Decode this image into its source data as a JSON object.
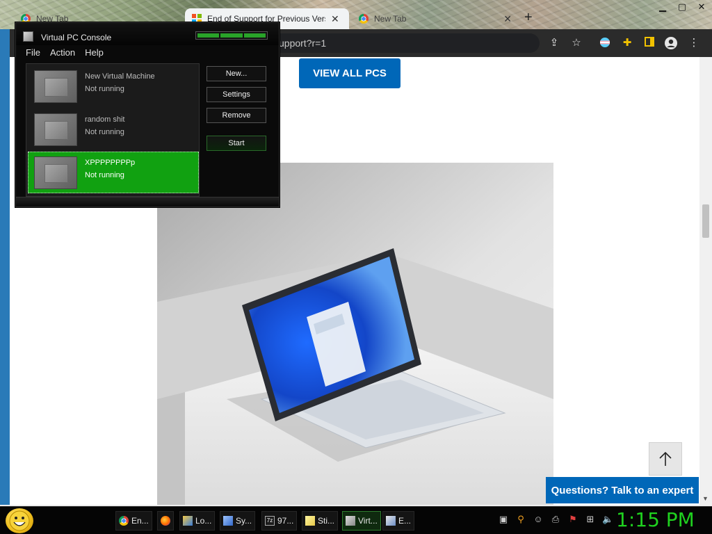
{
  "browser": {
    "tabs": [
      {
        "label": "New Tab",
        "active": false
      },
      {
        "label": "End of Support for Previous Vers",
        "active": true
      },
      {
        "label": "New Tab",
        "active": false
      }
    ],
    "url": "upport?r=1"
  },
  "page": {
    "view_all_label": "VIEW ALL PCS",
    "questions_label": "Questions? Talk to an expert"
  },
  "vpc": {
    "title": "Virtual PC Console",
    "menu": [
      "File",
      "Action",
      "Help"
    ],
    "machines": [
      {
        "name": "New Virtual Machine",
        "status": "Not running",
        "selected": false
      },
      {
        "name": "random shit",
        "status": "Not running",
        "selected": false
      },
      {
        "name": "XPPPPPPPPp",
        "status": "Not running",
        "selected": true
      }
    ],
    "buttons": {
      "new": "New...",
      "settings": "Settings",
      "remove": "Remove",
      "start": "Start"
    }
  },
  "taskbar": {
    "items": [
      {
        "label": "En...",
        "icon": "chrome-icon"
      },
      {
        "label": "",
        "icon": "firefox-icon"
      },
      {
        "label": "Lo...",
        "icon": "folder-picture-icon"
      },
      {
        "label": "Sy...",
        "icon": "system-properties-icon"
      },
      {
        "label": "97...",
        "icon": "7zip-icon"
      },
      {
        "label": "Sti...",
        "icon": "sticky-notes-icon"
      },
      {
        "label": "Virt...",
        "icon": "virtual-pc-icon"
      },
      {
        "label": "E...",
        "icon": "explorer-icon"
      }
    ],
    "clock": "1:15 PM"
  },
  "colors": {
    "accent_blue": "#0067b8",
    "vm_selected": "#11a111",
    "clock_green": "#1fd11f"
  }
}
